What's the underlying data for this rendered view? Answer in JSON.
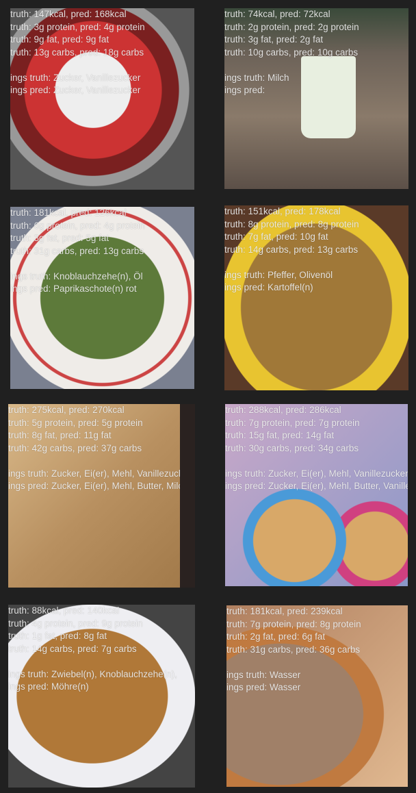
{
  "panels": [
    {
      "l1": "truth: 147kcal, pred: 168kcal",
      "l2": "truth: 3g protein, pred: 4g protein",
      "l3": "truth: 9g fat, pred: 9g fat",
      "l4": "truth: 13g carbs, pred: 18g carbs",
      "it": "ings truth: Zucker, Vanillezucker",
      "ip": "ings pred: Zucker, Vanillezucker"
    },
    {
      "l1": "truth: 74kcal, pred: 72kcal",
      "l2": "truth: 2g protein, pred: 2g protein",
      "l3": "truth: 3g fat, pred: 2g fat",
      "l4": "truth: 10g carbs, pred: 10g carbs",
      "it": "ings truth: Milch",
      "ip": "ings pred:"
    },
    {
      "l1": "truth: 181kcal, pred: 126kcal",
      "l2": "truth: 6g protein, pred: 4g protein",
      "l3": "truth: 3g fat, pred: 5g fat",
      "l4": "truth: 31g carbs, pred: 13g carbs",
      "it": "ings truth: Knoblauchzehe(n), Öl",
      "ip": "ings pred: Paprikaschote(n) rot"
    },
    {
      "l1": "truth: 151kcal, pred: 178kcal",
      "l2": "truth: 8g protein, pred: 8g protein",
      "l3": "truth: 7g fat, pred: 10g fat",
      "l4": "truth: 14g carbs, pred: 13g carbs",
      "it": "ings truth: Pfeffer, Olivenöl",
      "ip": "ings pred: Kartoffel(n)"
    },
    {
      "l1": "truth: 275kcal, pred: 270kcal",
      "l2": "truth: 5g protein, pred: 5g protein",
      "l3": "truth: 8g fat, pred: 11g fat",
      "l4": "truth: 42g carbs, pred: 37g carbs",
      "it": "ings truth: Zucker, Ei(er), Mehl, Vanillezucker",
      "ip": "ings pred: Zucker, Ei(er), Mehl, Butter, Milch"
    },
    {
      "l1": "truth: 288kcal, pred: 286kcal",
      "l2": "truth: 7g protein, pred: 7g protein",
      "l3": "truth: 15g fat, pred: 14g fat",
      "l4": "truth: 30g carbs, pred: 34g carbs",
      "it": "ings truth: Zucker, Ei(er), Mehl, Vanillezucker",
      "ip": "ings pred: Zucker, Ei(er), Mehl, Butter, Vanillezucker"
    },
    {
      "l1": "truth: 88kcal, pred: 140kcal",
      "l2": "truth: 4g protein, pred: 9g protein",
      "l3": "truth: 1g fat, pred: 8g fat",
      "l4": "truth: 14g carbs, pred: 7g carbs",
      "it": "ings truth: Zwiebel(n), Knoblauchzehe(n),",
      "ip": "ings pred: Möhre(n)"
    },
    {
      "l1": "truth: 181kcal, pred: 239kcal",
      "l2": "truth: 7g protein, pred: 8g protein",
      "l3": "truth: 2g fat, pred: 6g fat",
      "l4": "truth: 31g carbs, pred: 36g carbs",
      "it": "ings truth: Wasser",
      "ip": "ings pred: Wasser"
    }
  ]
}
